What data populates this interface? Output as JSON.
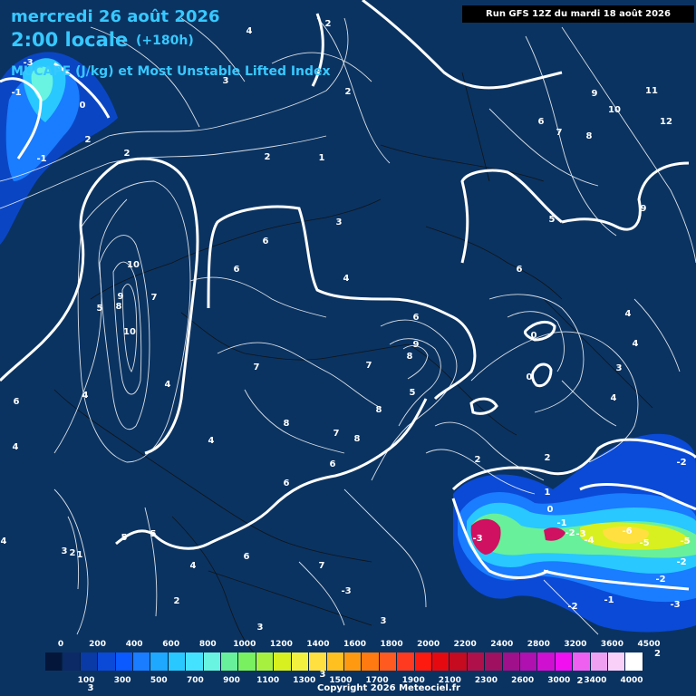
{
  "header": {
    "date_line": "mercredi 26 août 2026",
    "time_line": "2:00 locale",
    "forecast_offset": "(+180h)",
    "time_prefix": "2",
    "field_line": "MUCAPE (J/kg) et Most Unstable Lifted Index",
    "run_info": "Run GFS 12Z du mardi 18 août 2026"
  },
  "colors": {
    "background": "#0a3361",
    "title_text": "#37c8ff",
    "contour": "#ffffff"
  },
  "contour_labels": [
    {
      "text": "4"
    },
    {
      "text": "2"
    },
    {
      "text": "-3"
    },
    {
      "text": "-1"
    },
    {
      "text": "3"
    },
    {
      "text": "0"
    },
    {
      "text": "2"
    },
    {
      "text": "-1"
    },
    {
      "text": "2"
    },
    {
      "text": "2"
    },
    {
      "text": "1"
    },
    {
      "text": "2"
    },
    {
      "text": "9"
    },
    {
      "text": "11"
    },
    {
      "text": "10"
    },
    {
      "text": "12"
    },
    {
      "text": "6"
    },
    {
      "text": "7"
    },
    {
      "text": "8"
    },
    {
      "text": "10"
    },
    {
      "text": "9"
    },
    {
      "text": "8"
    },
    {
      "text": "7"
    },
    {
      "text": "5"
    },
    {
      "text": "10"
    },
    {
      "text": "6"
    },
    {
      "text": "6"
    },
    {
      "text": "3"
    },
    {
      "text": "4"
    },
    {
      "text": "5"
    },
    {
      "text": "9"
    },
    {
      "text": "6"
    },
    {
      "text": "6"
    },
    {
      "text": "9"
    },
    {
      "text": "8"
    },
    {
      "text": "0"
    },
    {
      "text": "0"
    },
    {
      "text": "4"
    },
    {
      "text": "4"
    },
    {
      "text": "3"
    },
    {
      "text": "4"
    },
    {
      "text": "7"
    },
    {
      "text": "7"
    },
    {
      "text": "5"
    },
    {
      "text": "4"
    },
    {
      "text": "6"
    },
    {
      "text": "4"
    },
    {
      "text": "8"
    },
    {
      "text": "8"
    },
    {
      "text": "7"
    },
    {
      "text": "8"
    },
    {
      "text": "4"
    },
    {
      "text": "6"
    },
    {
      "text": "2"
    },
    {
      "text": "2"
    },
    {
      "text": "-2"
    },
    {
      "text": "4"
    },
    {
      "text": "6"
    },
    {
      "text": "1"
    },
    {
      "text": "0"
    },
    {
      "text": "5"
    },
    {
      "text": "5"
    },
    {
      "text": "-3"
    },
    {
      "text": "-1"
    },
    {
      "text": "-2"
    },
    {
      "text": "-3"
    },
    {
      "text": "-4"
    },
    {
      "text": "-6"
    },
    {
      "text": "-5"
    },
    {
      "text": "-5"
    },
    {
      "text": "-2"
    },
    {
      "text": "3"
    },
    {
      "text": "2"
    },
    {
      "text": "1"
    },
    {
      "text": "4"
    },
    {
      "text": "6"
    },
    {
      "text": "7"
    },
    {
      "text": "-3"
    },
    {
      "text": "2"
    },
    {
      "text": "3"
    },
    {
      "text": "3"
    },
    {
      "text": "-2"
    },
    {
      "text": "-1"
    },
    {
      "text": "-3"
    },
    {
      "text": "-2"
    },
    {
      "text": "3"
    },
    {
      "text": "3"
    },
    {
      "text": "2"
    },
    {
      "text": "4"
    }
  ],
  "legend": {
    "colors": [
      "#05163b",
      "#0b2a66",
      "#0a3aa6",
      "#0a4ad6",
      "#0a5aff",
      "#1a7cff",
      "#1ea8ff",
      "#29c8ff",
      "#45e2ff",
      "#68f4e0",
      "#69f09a",
      "#78f060",
      "#a8f040",
      "#d8f020",
      "#f4f040",
      "#ffe040",
      "#ffc020",
      "#ff9a10",
      "#ff7a10",
      "#ff5a20",
      "#ff3a20",
      "#ff1a10",
      "#e60a10",
      "#c60a20",
      "#b0104a",
      "#a01060",
      "#a0108a",
      "#b010b0",
      "#d010d0",
      "#f010f0",
      "#f060f0",
      "#f0a0f0",
      "#f8d0f8",
      "#ffffff"
    ],
    "top_ticks": [
      "0",
      "200",
      "400",
      "600",
      "800",
      "1000",
      "1200",
      "1400",
      "1600",
      "1800",
      "2000",
      "2200",
      "2400",
      "2800",
      "3200",
      "3600",
      "4500"
    ],
    "bottom_ticks": [
      "100",
      "300",
      "500",
      "700",
      "900",
      "1100",
      "1300",
      "1500",
      "1700",
      "1900",
      "2100",
      "2300",
      "2600",
      "3000",
      "3400",
      "4000"
    ],
    "side_label": "2"
  },
  "copyright": "Copyright 2026 Meteociel.fr"
}
